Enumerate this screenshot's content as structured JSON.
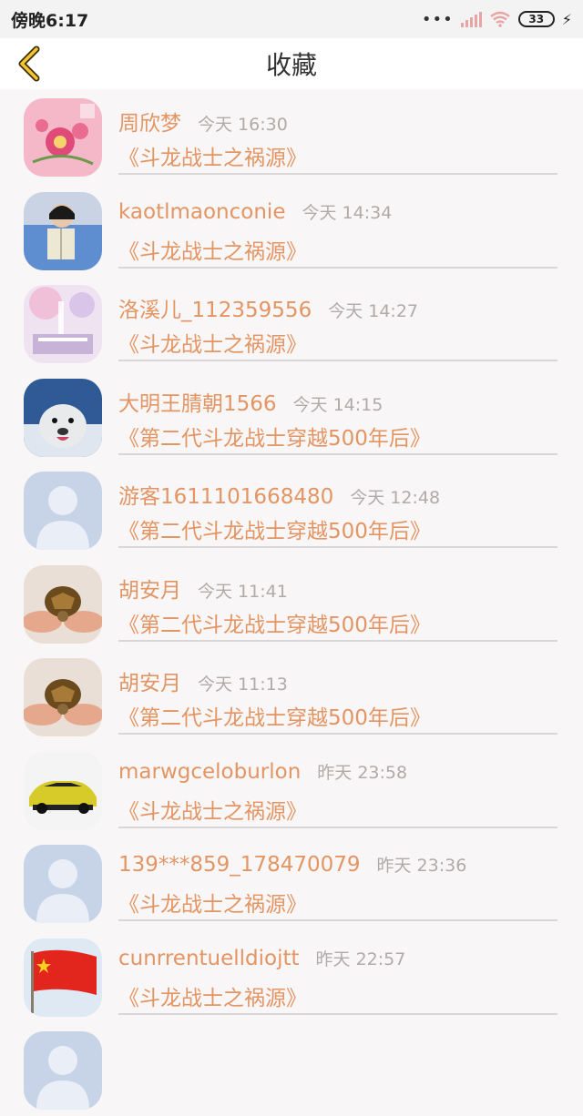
{
  "status": {
    "time": "傍晚6:17",
    "dots": "•••",
    "battery": "33"
  },
  "header": {
    "title": "收藏"
  },
  "favorites": [
    {
      "user": "周欣梦",
      "time": "今天 16:30",
      "title": "《斗龙战士之祸源》",
      "avatar": "flower-painting"
    },
    {
      "user": "kaotlmaonconie",
      "time": "今天 14:34",
      "title": "《斗龙战士之祸源》",
      "avatar": "person-reading"
    },
    {
      "user": "洛溪儿_112359556",
      "time": "今天 14:27",
      "title": "《斗龙战士之祸源》",
      "avatar": "pastel-illustration"
    },
    {
      "user": "大明王腈朝1566",
      "time": "今天 14:15",
      "title": "《第二代斗龙战士穿越500年后》",
      "avatar": "seal"
    },
    {
      "user": "游客1611101668480",
      "time": "今天 12:48",
      "title": "《第二代斗龙战士穿越500年后》",
      "avatar": "default-user"
    },
    {
      "user": "胡安月",
      "time": "今天 11:41",
      "title": "《第二代斗龙战士穿越500年后》",
      "avatar": "turtle"
    },
    {
      "user": "胡安月",
      "time": "今天 11:13",
      "title": "《第二代斗龙战士穿越500年后》",
      "avatar": "turtle"
    },
    {
      "user": "marwgceloburlon",
      "time": "昨天 23:58",
      "title": "《斗龙战士之祸源》",
      "avatar": "sports-car"
    },
    {
      "user": "139***859_178470079",
      "time": "昨天 23:36",
      "title": "《斗龙战士之祸源》",
      "avatar": "default-user"
    },
    {
      "user": "cunrrentuelldiojtt",
      "time": "昨天 22:57",
      "title": "《斗龙战士之祸源》",
      "avatar": "red-flag"
    }
  ]
}
